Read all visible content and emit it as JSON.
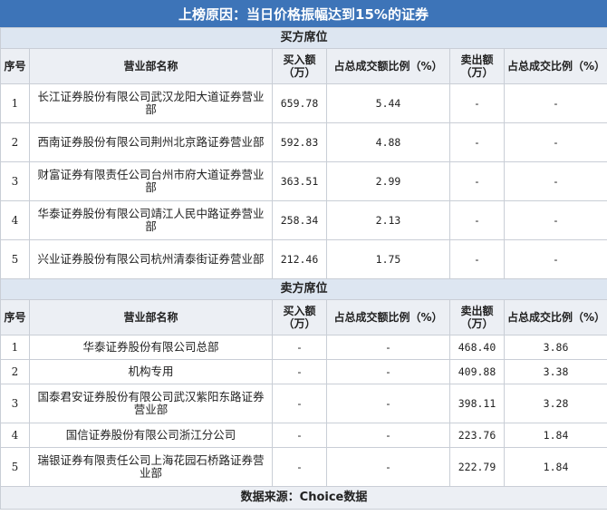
{
  "title": "上榜原因：当日价格振幅达到15%的证券",
  "buy_section": {
    "label": "买方席位",
    "headers": [
      "序号",
      "营业部名称",
      "买入额（万）",
      "占总成交额比例（%）",
      "卖出额（万）",
      "占总成交比例（%）"
    ],
    "rows": [
      {
        "no": "1",
        "name": "长江证券股份有限公司武汉龙阳大道证券营业部",
        "buy": "659.78",
        "buy_pct": "5.44",
        "sell": "-",
        "sell_pct": "-"
      },
      {
        "no": "2",
        "name": "西南证券股份有限公司荆州北京路证券营业部",
        "buy": "592.83",
        "buy_pct": "4.88",
        "sell": "-",
        "sell_pct": "-"
      },
      {
        "no": "3",
        "name": "财富证券有限责任公司台州市府大道证券营业部",
        "buy": "363.51",
        "buy_pct": "2.99",
        "sell": "-",
        "sell_pct": "-"
      },
      {
        "no": "4",
        "name": "华泰证券股份有限公司靖江人民中路证券营业部",
        "buy": "258.34",
        "buy_pct": "2.13",
        "sell": "-",
        "sell_pct": "-"
      },
      {
        "no": "5",
        "name": "兴业证券股份有限公司杭州清泰街证券营业部",
        "buy": "212.46",
        "buy_pct": "1.75",
        "sell": "-",
        "sell_pct": "-"
      }
    ]
  },
  "sell_section": {
    "label": "卖方席位",
    "headers": [
      "序号",
      "营业部名称",
      "买入额（万）",
      "占总成交额比例（%）",
      "卖出额（万）",
      "占总成交比例（%）"
    ],
    "rows": [
      {
        "no": "1",
        "name": "华泰证券股份有限公司总部",
        "buy": "-",
        "buy_pct": "-",
        "sell": "468.40",
        "sell_pct": "3.86"
      },
      {
        "no": "2",
        "name": "机构专用",
        "buy": "-",
        "buy_pct": "-",
        "sell": "409.88",
        "sell_pct": "3.38"
      },
      {
        "no": "3",
        "name": "国泰君安证券股份有限公司武汉紫阳东路证券营业部",
        "buy": "-",
        "buy_pct": "-",
        "sell": "398.11",
        "sell_pct": "3.28"
      },
      {
        "no": "4",
        "name": "国信证券股份有限公司浙江分公司",
        "buy": "-",
        "buy_pct": "-",
        "sell": "223.76",
        "sell_pct": "1.84"
      },
      {
        "no": "5",
        "name": "瑞银证券有限责任公司上海花园石桥路证券营业部",
        "buy": "-",
        "buy_pct": "-",
        "sell": "222.79",
        "sell_pct": "1.84"
      }
    ]
  },
  "footer": "数据来源：Choice数据"
}
